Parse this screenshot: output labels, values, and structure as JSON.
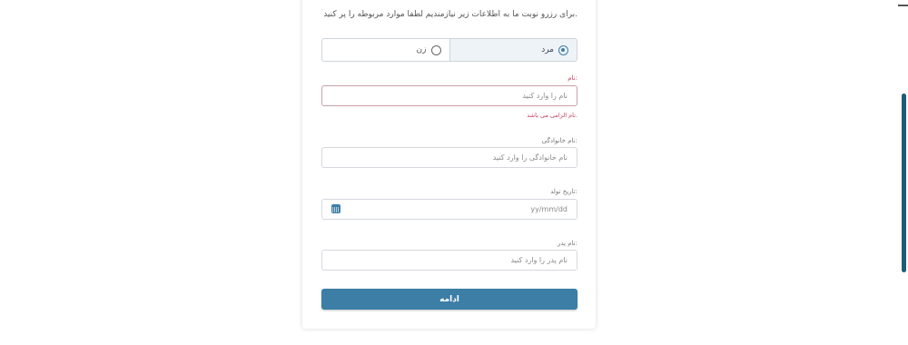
{
  "form": {
    "intro": "برای رزرو نوبت ما به اطلاعات زیر نیازمندیم لطفا موارد مربوطه را پر کنید.",
    "gender_male": "مرد",
    "gender_female": "زن",
    "first_name_label": "نام:",
    "first_name_placeholder": "نام را وارد کنید",
    "first_name_error": "نام الزامی می باشد.",
    "last_name_label": "نام خانوادگی:",
    "last_name_placeholder": "نام خانوادگی را وارد کنید",
    "birth_date_label": "تاریخ تولد:",
    "birth_date_placeholder": "yy/mm/dd",
    "father_name_label": "نام پدر:",
    "father_name_placeholder": "نام پدر را وارد کنید",
    "submit_label": "ادامه"
  },
  "colors": {
    "accent": "#3d7ea6",
    "error": "#c04060"
  }
}
